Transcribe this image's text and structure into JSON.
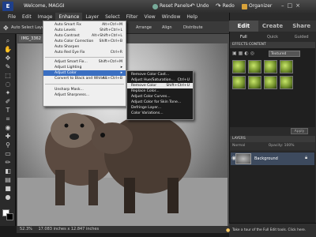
{
  "titlebar": {
    "logo": "E",
    "welcome": "Welcome, MAGGI",
    "reset_panels": "Reset Panels",
    "undo": "Undo",
    "redo": "Redo",
    "organizer": "Organizer"
  },
  "menubar": [
    "File",
    "Edit",
    "Image",
    "Enhance",
    "Layer",
    "Select",
    "Filter",
    "View",
    "Window",
    "Help"
  ],
  "options": {
    "tool_label": "Auto Select Layer",
    "arrange": "Arrange",
    "align": "Align",
    "distribute": "Distribute"
  },
  "document": {
    "tab": "IMG_3362",
    "zoom": "52.3%",
    "size": "17.083 inches x 12.847 inches"
  },
  "enhance_menu": {
    "items": [
      {
        "label": "Auto Smart Fix",
        "shortcut": "Alt+Ctrl+M"
      },
      {
        "label": "Auto Levels",
        "shortcut": "Shift+Ctrl+L"
      },
      {
        "label": "Auto Contrast",
        "shortcut": "Alt+Shift+Ctrl+L"
      },
      {
        "label": "Auto Color Correction",
        "shortcut": "Shift+Ctrl+B"
      },
      {
        "label": "Auto Sharpen",
        "shortcut": ""
      },
      {
        "label": "Auto Red Eye Fix",
        "shortcut": "Ctrl+R"
      },
      {
        "label": "Adjust Smart Fix...",
        "shortcut": "Shift+Ctrl+M"
      },
      {
        "label": "Adjust Lighting",
        "shortcut": ""
      },
      {
        "label": "Adjust Color",
        "shortcut": ""
      },
      {
        "label": "Convert to Black and White...",
        "shortcut": "Alt+Ctrl+B"
      },
      {
        "label": "Unsharp Mask...",
        "shortcut": ""
      },
      {
        "label": "Adjust Sharpness...",
        "shortcut": ""
      }
    ]
  },
  "adjust_color_menu": {
    "items": [
      {
        "label": "Remove Color Cast...",
        "shortcut": ""
      },
      {
        "label": "Adjust Hue/Saturation...",
        "shortcut": "Ctrl+U"
      },
      {
        "label": "Remove Color",
        "shortcut": "Shift+Ctrl+U"
      },
      {
        "label": "Replace Color...",
        "shortcut": ""
      },
      {
        "label": "Adjust Color Curves...",
        "shortcut": ""
      },
      {
        "label": "Adjust Color for Skin Tone...",
        "shortcut": ""
      },
      {
        "label": "Defringe Layer...",
        "shortcut": ""
      },
      {
        "label": "Color Variations...",
        "shortcut": ""
      }
    ]
  },
  "panel": {
    "tabs": [
      "Edit",
      "Create",
      "Share"
    ],
    "subtabs": [
      "Full",
      "Quick",
      "Guided"
    ],
    "effects_head": "EFFECTS   CONTENT",
    "effects_dropdown": "Textured",
    "apply": "Apply",
    "layers_head": "LAYERS",
    "layers_mode": "Normal",
    "layers_opacity": "Opacity: 100%",
    "layer_name": "Background",
    "tip": "Take a tour of the Full Edit tools. Click here."
  },
  "colors": {
    "highlight": "#3a6fc2",
    "panel": "#2b2b2b"
  }
}
